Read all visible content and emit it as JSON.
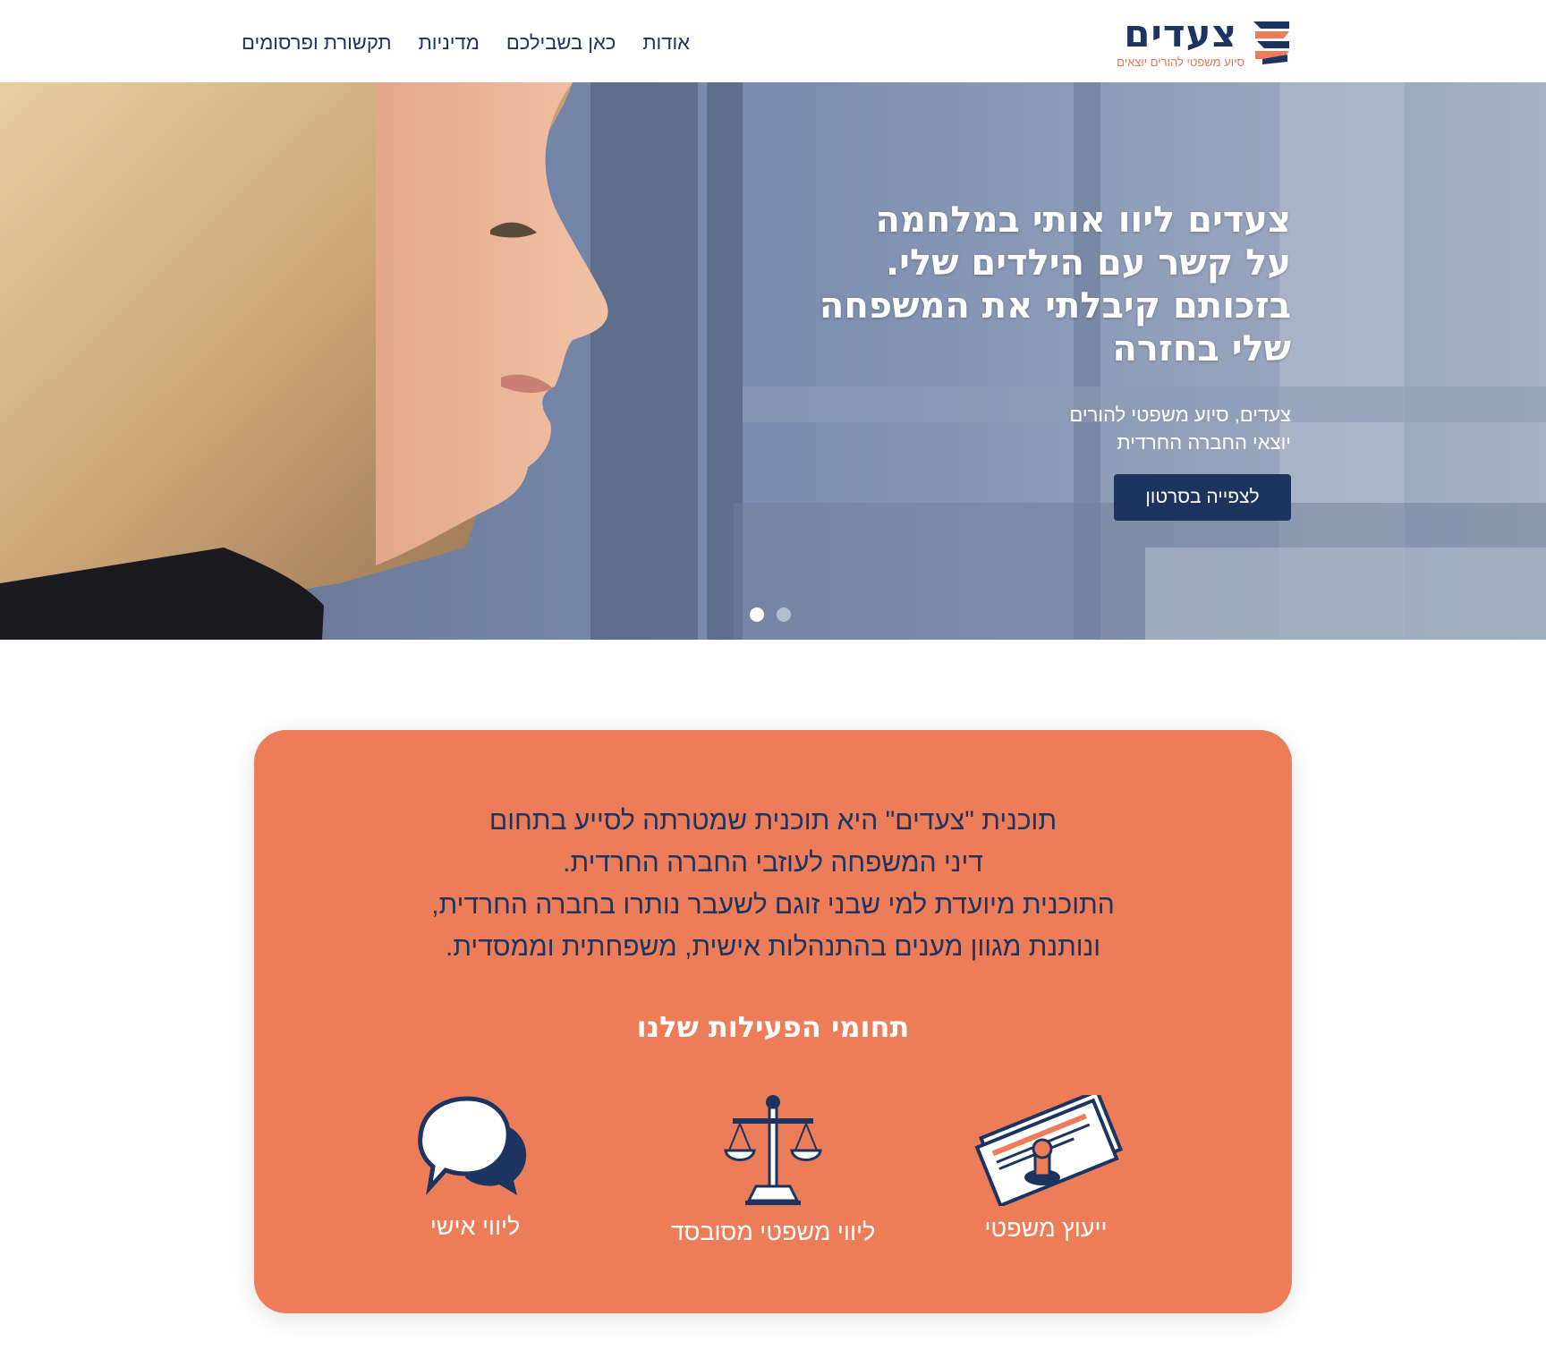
{
  "header": {
    "logo_title": "צעדים",
    "logo_sub": "סיוע משפטי להורים יוצאים",
    "nav": [
      "אודות",
      "כאן בשבילכם",
      "מדיניות",
      "תקשורת ופרסומים"
    ]
  },
  "hero": {
    "title_lines": [
      "צעדים ליוו אותי במלחמה",
      "על קשר עם הילדים שלי.",
      "בזכותם קיבלתי את המשפחה",
      "שלי בחזרה"
    ],
    "subtitle_lines": [
      "צעדים, סיוע משפטי להורים",
      "יוצאי החברה החרדית"
    ],
    "button": "לצפייה בסרטון",
    "slides": {
      "count": 2,
      "active_index": 1
    }
  },
  "card": {
    "intro_lines": [
      "תוכנית \"צעדים\" היא תוכנית שמטרתה לסייע בתחום",
      "דיני המשפחה לעוזבי החברה החרדית.",
      "התוכנית מיועדת למי שבני זוגם לשעבר נותרו בחברה החרדית,",
      "ונותנת מגוון מענים בהתנהלות אישית, משפחתית וממסדית."
    ],
    "activities_title": "תחומי הפעילות שלנו",
    "features": [
      {
        "label": "ייעוץ משפטי",
        "icon": "legal-documents-stamp-icon"
      },
      {
        "label": "ליווי משפטי מסובסד",
        "icon": "scales-of-justice-icon"
      },
      {
        "label": "ליווי אישי",
        "icon": "chat-bubbles-icon"
      }
    ]
  },
  "colors": {
    "navy": "#1d3461",
    "orange": "#ec7d58",
    "white": "#ffffff"
  }
}
